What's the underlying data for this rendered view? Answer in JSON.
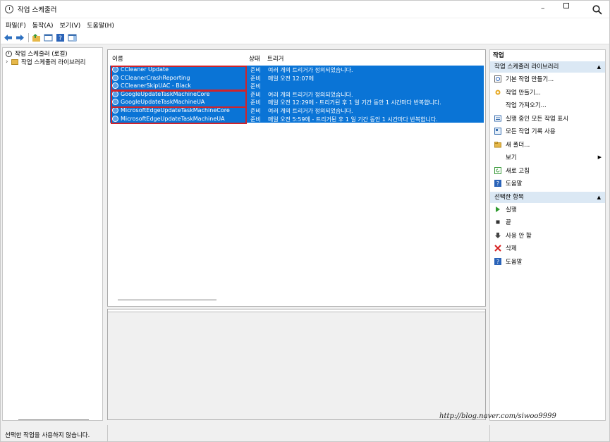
{
  "window": {
    "title": "작업 스케줄러"
  },
  "menu": [
    "파일(F)",
    "동작(A)",
    "보기(V)",
    "도움말(H)"
  ],
  "tree": {
    "root": "작업 스케줄러 (로컬)",
    "child": "작업 스케줄러 라이브러리",
    "expander": "›"
  },
  "table": {
    "headers": {
      "name": "이름",
      "status": "상태",
      "trigger": "트리거"
    },
    "rows": [
      {
        "name": "CCleaner Update",
        "status": "준비",
        "trigger": "여러 개의 트리거가 정의되었습니다."
      },
      {
        "name": "CCleanerCrashReporting",
        "status": "준비",
        "trigger": "매일 오전 12:07에"
      },
      {
        "name": "CCleanerSkipUAC - Black",
        "status": "준비",
        "trigger": ""
      },
      {
        "name": "GoogleUpdateTaskMachineCore",
        "status": "준비",
        "trigger": "여러 개의 트리거가 정의되었습니다."
      },
      {
        "name": "GoogleUpdateTaskMachineUA",
        "status": "준비",
        "trigger": "매일 오전 12:29에 - 트리거된 후 1 일 기간 동안 1 시간마다 반복합니다."
      },
      {
        "name": "MicrosoftEdgeUpdateTaskMachineCore",
        "status": "준비",
        "trigger": "여러 개의 트리거가 정의되었습니다."
      },
      {
        "name": "MicrosoftEdgeUpdateTaskMachineUA",
        "status": "준비",
        "trigger": "매일 오전 5:59에 - 트리거된 후 1 일 기간 동안 1 시간마다 반복합니다."
      }
    ]
  },
  "actions": {
    "heading": "작업",
    "library_section": "작업 스케줄러 라이브러리",
    "library_items": [
      {
        "label": "기본 작업 만들기...",
        "icon": "basic-task-icon"
      },
      {
        "label": "작업 만들기...",
        "icon": "create-task-icon"
      },
      {
        "label": "작업 가져오기...",
        "icon": ""
      },
      {
        "label": "실행 중인 모든 작업 표시",
        "icon": "running-tasks-icon"
      },
      {
        "label": "모든 작업 기록 사용",
        "icon": "history-icon"
      },
      {
        "label": "새 폴더...",
        "icon": "folder-icon"
      },
      {
        "label": "보기",
        "icon": "",
        "submenu": "▶"
      },
      {
        "label": "새로 고침",
        "icon": "refresh-icon"
      },
      {
        "label": "도움말",
        "icon": "help-icon"
      }
    ],
    "selected_section": "선택한 항목",
    "selected_items": [
      {
        "label": "실행",
        "icon": "run-icon"
      },
      {
        "label": "끝",
        "icon": "end-icon"
      },
      {
        "label": "사용 안 함",
        "icon": "disable-icon"
      },
      {
        "label": "삭제",
        "icon": "delete-icon"
      },
      {
        "label": "도움말",
        "icon": "help-icon"
      }
    ],
    "collapse_glyph": "▲"
  },
  "status_bar": {
    "text": "선택한 작업을 사용하지 않습니다."
  },
  "watermark": "http://blog.naver.com/siwoo9999",
  "colors": {
    "selection": "#0a74d6",
    "highlight_box": "#d0232a",
    "section_bg": "#dbe8f4"
  }
}
